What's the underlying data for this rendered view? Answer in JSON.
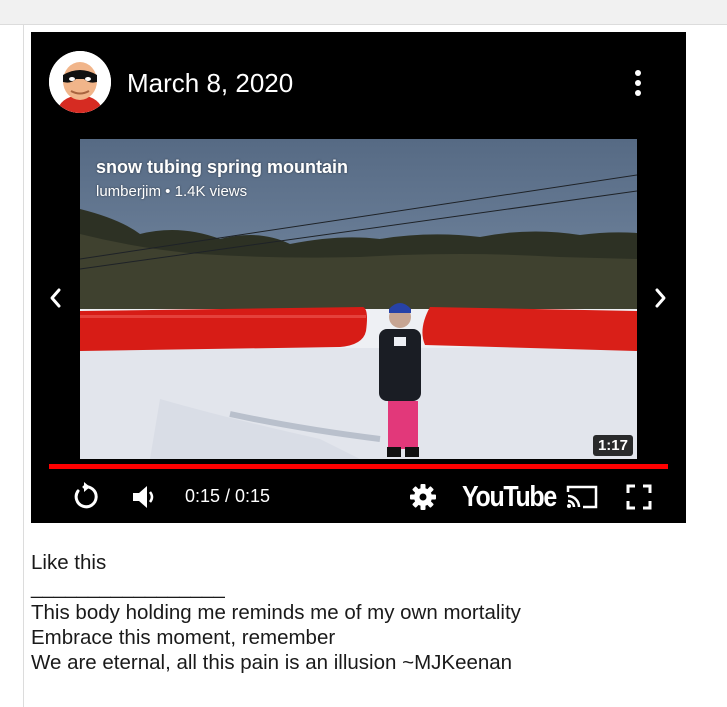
{
  "post": {
    "date": "March 8, 2020"
  },
  "video": {
    "title": "snow tubing spring mountain",
    "meta": "lumberjim • 1.4K views",
    "duration": "1:17",
    "time_display": "0:15 / 0:15",
    "progress_fraction": 1.0,
    "brand": "YouTube"
  },
  "icons": {
    "menu": "more-vert-icon",
    "prev": "chevron-left-icon",
    "next": "chevron-right-icon",
    "replay": "replay-icon",
    "volume": "volume-icon",
    "settings": "gear-icon",
    "cast": "cast-icon",
    "fullscreen": "fullscreen-icon"
  },
  "caption": {
    "line1": "Like this",
    "divider": "_________________",
    "line2": "This body holding me reminds me of my own mortality",
    "line3": "Embrace this moment, remember",
    "line4": "We are eternal, all this pain is an illusion ~MJKeenan"
  },
  "colors": {
    "accent": "#ff0000",
    "player_bg": "#000000"
  }
}
